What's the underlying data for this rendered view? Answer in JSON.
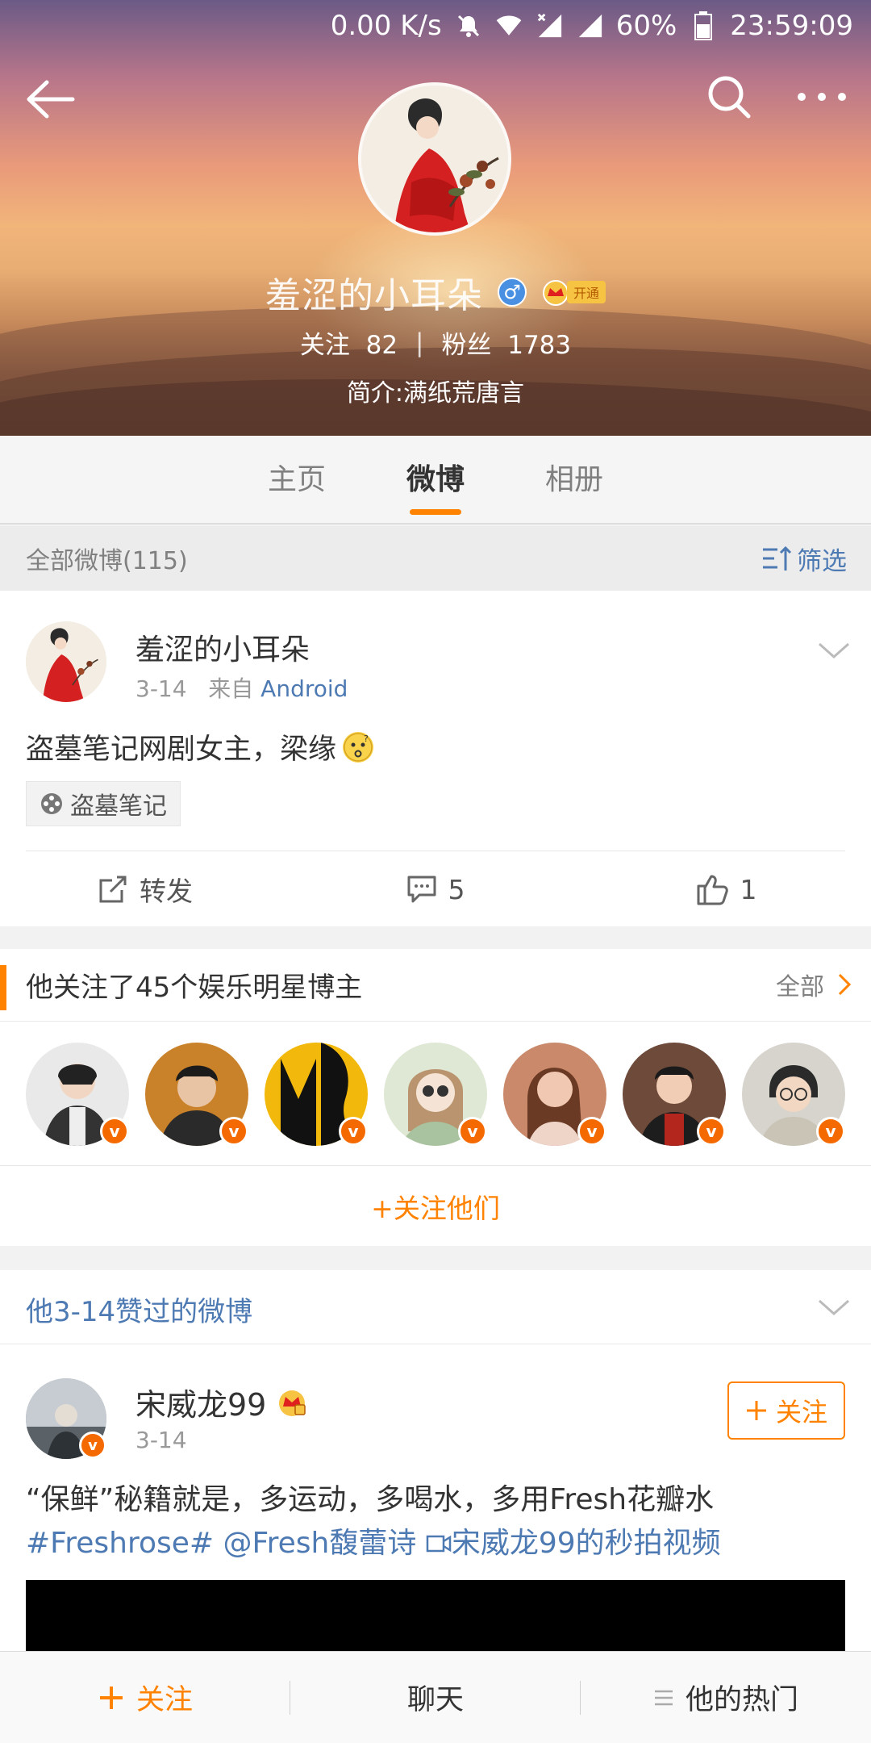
{
  "status_bar": {
    "net_speed": "0.00 K/s",
    "battery": "60%",
    "time": "23:59:09"
  },
  "profile": {
    "name": "羞涩的小耳朵",
    "vip_label": "开通",
    "following_label": "关注",
    "following_count": "82",
    "separator": "|",
    "fans_label": "粉丝",
    "fans_count": "1783",
    "bio": "简介:满纸荒唐言"
  },
  "tabs": [
    {
      "label": "主页"
    },
    {
      "label": "微博"
    },
    {
      "label": "相册"
    }
  ],
  "filter": {
    "count_label": "全部微博(115)",
    "filter_label": "筛选"
  },
  "post": {
    "author": "羞涩的小耳朵",
    "date": "3-14",
    "from": "来自",
    "source": "Android",
    "text": "盗墓笔记网剧女主，梁缘",
    "topic": "盗墓笔记",
    "actions": {
      "repost": "转发",
      "comments": "5",
      "likes": "1"
    }
  },
  "following_card": {
    "title": "他关注了45个娱乐明星博主",
    "all": "全部",
    "follow_them": "+关注他们",
    "verified_glyph": "v"
  },
  "liked_section": {
    "title": "他3-14赞过的微博"
  },
  "post2": {
    "author": "宋威龙99",
    "date": "3-14",
    "follow_label": "关注",
    "line1": "“保鲜”秘籍就是，多运动，多喝水，多用Fresh花瓣水",
    "hashtag": "#Freshrose#",
    "mention": "@Fresh馥蕾诗",
    "video": "宋威龙99的秒拍视频"
  },
  "bottom_bar": {
    "follow": "关注",
    "chat": "聊天",
    "hot": "他的热门"
  },
  "colors": {
    "accent": "#ff8200",
    "link": "#4e7ab3"
  }
}
